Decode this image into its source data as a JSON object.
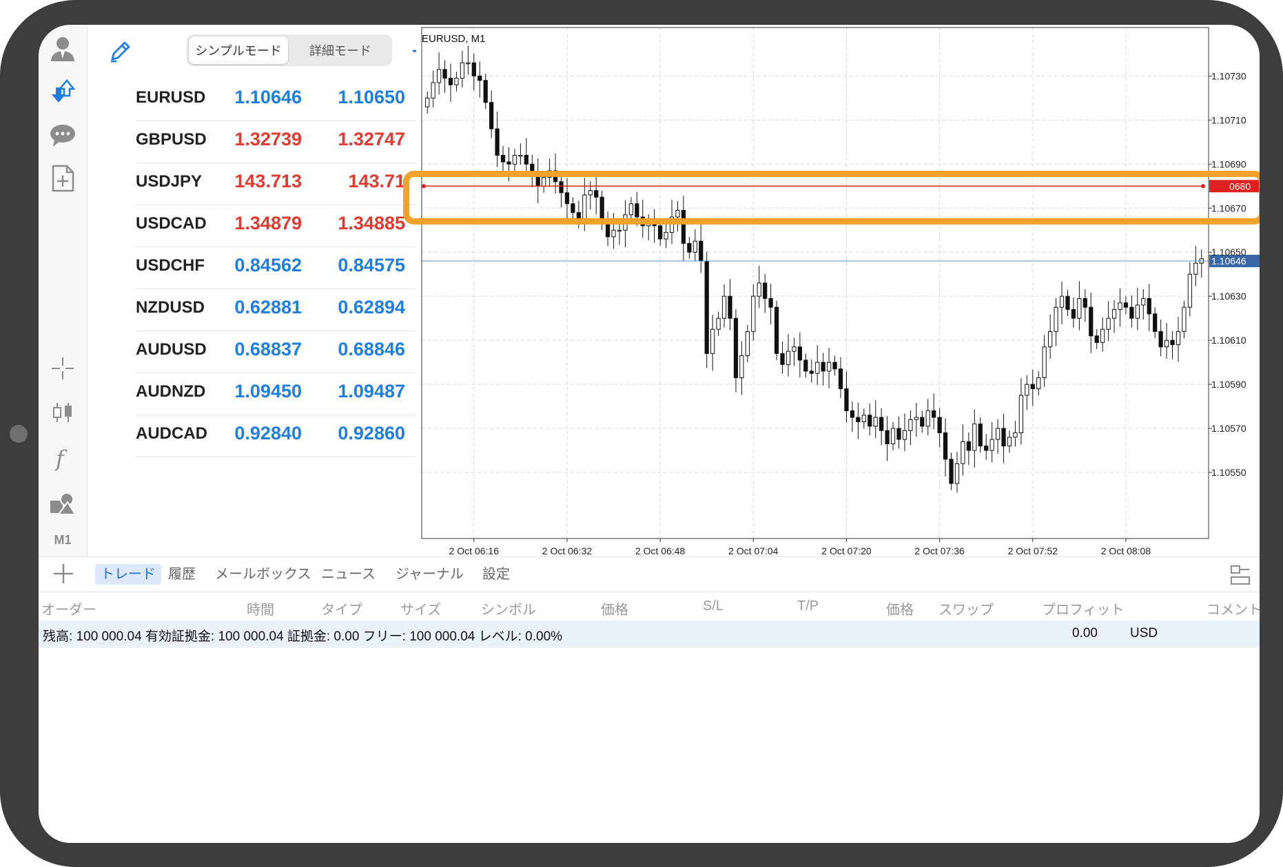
{
  "toolbar": {
    "timeframe": "M1",
    "icons": [
      "account-icon",
      "trade-icon",
      "chat-icon",
      "new-order-icon",
      "crosshair-icon",
      "chart-type-icon",
      "indicator-icon",
      "objects-icon"
    ]
  },
  "quotes": {
    "mode_simple": "シンプルモード",
    "mode_detail": "詳細モード",
    "rows": [
      {
        "symbol": "EURUSD",
        "bid": "1.10646",
        "ask": "1.10650",
        "color": "#1e7fe0"
      },
      {
        "symbol": "GBPUSD",
        "bid": "1.32739",
        "ask": "1.32747",
        "color": "#e23a2e"
      },
      {
        "symbol": "USDJPY",
        "bid": "143.713",
        "ask": "143.71",
        "color": "#e23a2e"
      },
      {
        "symbol": "USDCAD",
        "bid": "1.34879",
        "ask": "1.34885",
        "color": "#e23a2e"
      },
      {
        "symbol": "USDCHF",
        "bid": "0.84562",
        "ask": "0.84575",
        "color": "#1e7fe0"
      },
      {
        "symbol": "NZDUSD",
        "bid": "0.62881",
        "ask": "0.62894",
        "color": "#1e7fe0"
      },
      {
        "symbol": "AUDUSD",
        "bid": "0.68837",
        "ask": "0.68846",
        "color": "#1e7fe0"
      },
      {
        "symbol": "AUDNZD",
        "bid": "1.09450",
        "ask": "1.09487",
        "color": "#1e7fe0"
      },
      {
        "symbol": "AUDCAD",
        "bid": "0.92840",
        "ask": "0.92860",
        "color": "#1e7fe0"
      }
    ]
  },
  "chart": {
    "title": "EURUSD, M1",
    "current_price_label": "1.10646",
    "hline_price_label": "0680",
    "highlight_color": "#f2a12a",
    "line_color": "#e02020"
  },
  "chart_data": {
    "type": "candlestick",
    "title": "EURUSD, M1",
    "y_ticks": [
      "1.10730",
      "1.10710",
      "1.10690",
      "1.10670",
      "1.10650",
      "1.10630",
      "1.10610",
      "1.10590",
      "1.10570",
      "1.10550"
    ],
    "y_tick_values": [
      1.1073,
      1.1071,
      1.1069,
      1.1067,
      1.1065,
      1.1063,
      1.1061,
      1.1059,
      1.1057,
      1.1055
    ],
    "x_ticks": [
      "2 Oct 06:16",
      "2 Oct 06:32",
      "2 Oct 06:48",
      "2 Oct 07:04",
      "2 Oct 07:20",
      "2 Oct 07:36",
      "2 Oct 07:52",
      "2 Oct 08:08"
    ],
    "ylim": [
      1.1052,
      1.10752
    ],
    "current_price": 1.10646,
    "horizontal_line": 1.1068,
    "grid": true,
    "closes": [
      1.1072,
      1.10727,
      1.10733,
      1.10729,
      1.10726,
      1.10729,
      1.10736,
      1.10736,
      1.1073,
      1.10728,
      1.10718,
      1.10706,
      1.10694,
      1.10691,
      1.1069,
      1.10694,
      1.10694,
      1.1069,
      1.10686,
      1.1068,
      1.10684,
      1.10687,
      1.10682,
      1.10677,
      1.10672,
      1.10668,
      1.10665,
      1.10676,
      1.10678,
      1.10675,
      1.10663,
      1.10657,
      1.1066,
      1.1066,
      1.10667,
      1.10672,
      1.10666,
      1.10662,
      1.10663,
      1.10662,
      1.10656,
      1.10659,
      1.10666,
      1.10669,
      1.10654,
      1.1065,
      1.10655,
      1.10646,
      1.10604,
      1.10615,
      1.1062,
      1.1063,
      1.1062,
      1.10593,
      1.10603,
      1.10614,
      1.1063,
      1.10636,
      1.10629,
      1.10625,
      1.10604,
      1.10599,
      1.10605,
      1.10607,
      1.10601,
      1.10596,
      1.10595,
      1.106,
      1.10596,
      1.106,
      1.10597,
      1.10588,
      1.10578,
      1.10575,
      1.10573,
      1.10576,
      1.10571,
      1.10575,
      1.10569,
      1.10563,
      1.1057,
      1.10565,
      1.10569,
      1.10574,
      1.10575,
      1.10571,
      1.10578,
      1.10575,
      1.10568,
      1.10556,
      1.10545,
      1.10554,
      1.10564,
      1.1056,
      1.10572,
      1.10562,
      1.1056,
      1.10565,
      1.1057,
      1.10562,
      1.10566,
      1.10568,
      1.10585,
      1.1059,
      1.10588,
      1.10593,
      1.10607,
      1.10614,
      1.10625,
      1.1063,
      1.10624,
      1.1062,
      1.10629,
      1.10625,
      1.10612,
      1.10609,
      1.10615,
      1.1062,
      1.10624,
      1.10627,
      1.10625,
      1.1062,
      1.10626,
      1.10629,
      1.10622,
      1.10614,
      1.10607,
      1.1061,
      1.10608,
      1.10614,
      1.10625,
      1.1064,
      1.10645,
      1.10647
    ]
  },
  "bottom": {
    "tabs": [
      "トレード",
      "履歴",
      "メールボックス",
      "ニュース",
      "ジャーナル",
      "設定"
    ],
    "active_tab": "トレード",
    "columns": [
      "オーダー",
      "時間",
      "タイプ",
      "サイズ",
      "シンボル",
      "価格",
      "S/L",
      "T/P",
      "価格",
      "スワップ",
      "プロフィット",
      "コメント"
    ],
    "balance_text": "残高: 100 000.04 有効証拠金: 100 000.04 証拠金: 0.00 フリー: 100 000.04 レベル: 0.00%",
    "profit": "0.00",
    "currency": "USD"
  }
}
